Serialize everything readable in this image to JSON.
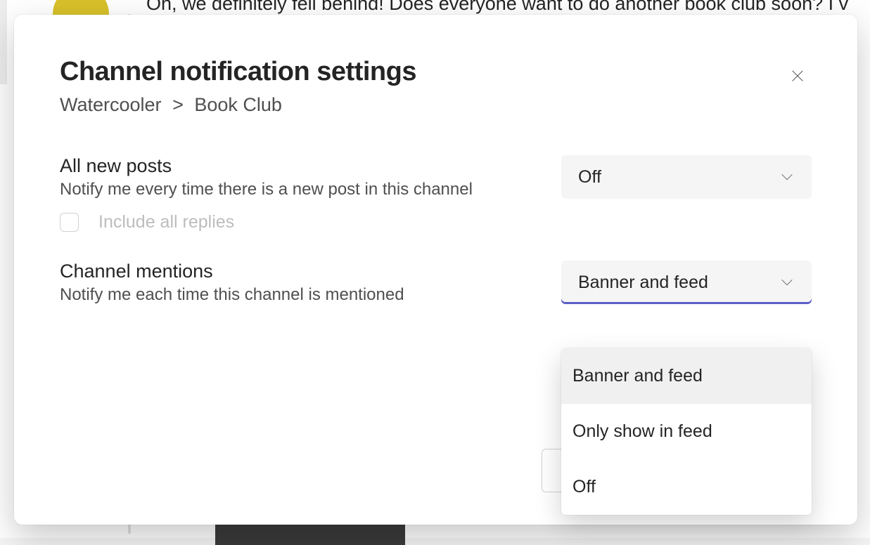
{
  "background": {
    "message_line": "Oh, we definitely fell behind! Does everyone want to do another book club soon? I v"
  },
  "modal": {
    "title": "Channel notification settings",
    "breadcrumb": {
      "team": "Watercooler",
      "separator": ">",
      "channel": "Book Club"
    },
    "settings": {
      "all_new_posts": {
        "title": "All new posts",
        "description": "Notify me every time there is a new post in this channel",
        "value": "Off"
      },
      "include_replies": {
        "label": "Include all replies",
        "checked": false,
        "disabled": true
      },
      "channel_mentions": {
        "title": "Channel mentions",
        "description": "Notify me each time this channel is mentioned",
        "value": "Banner and feed",
        "options": [
          "Banner and feed",
          "Only show in feed",
          "Off"
        ]
      }
    }
  }
}
